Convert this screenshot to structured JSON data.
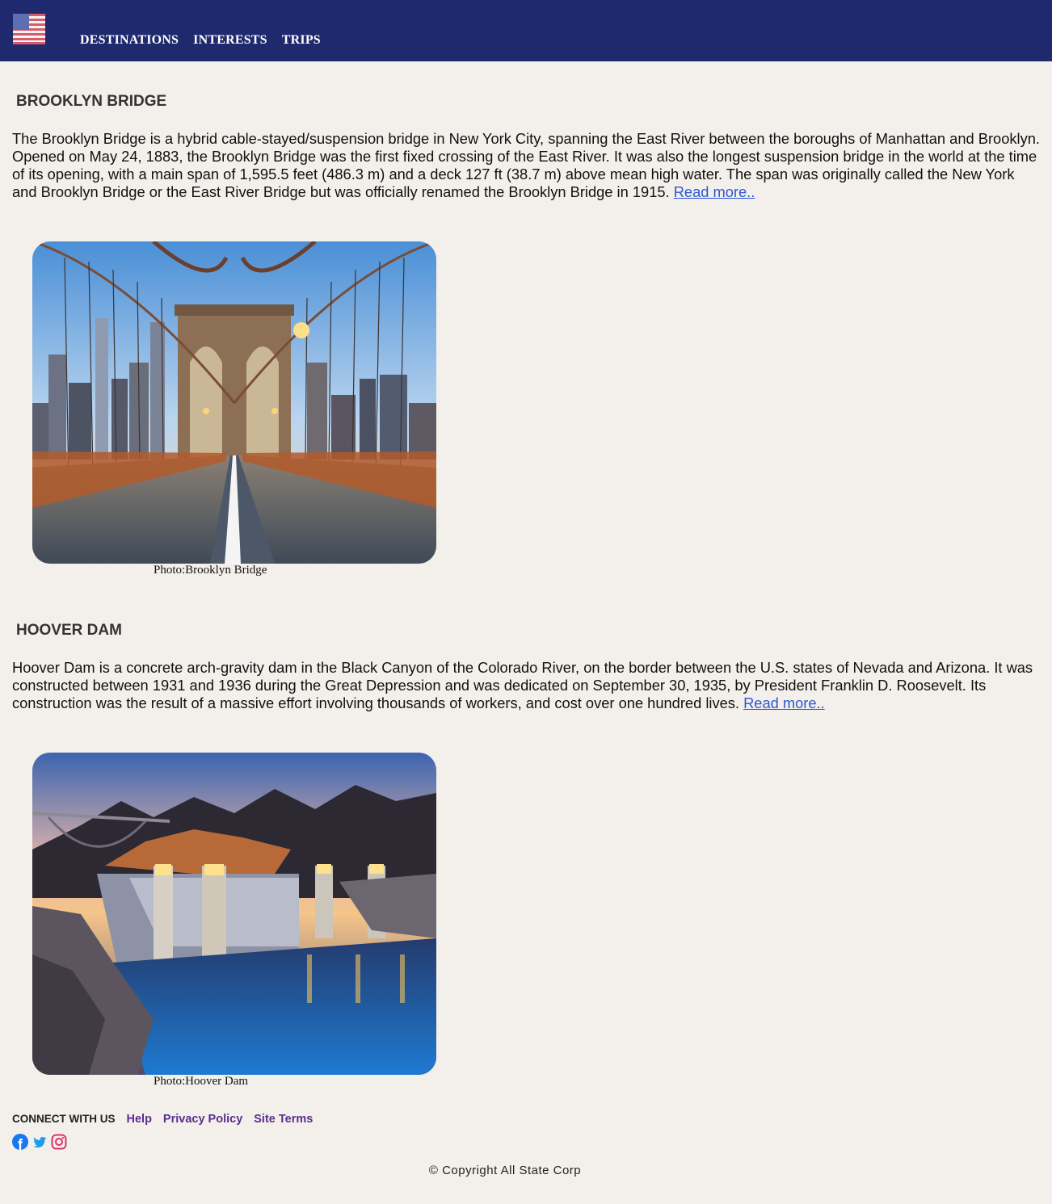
{
  "header": {
    "flag_icon": "us-flag-icon",
    "nav": [
      "DESTINATIONS",
      "INTERESTS",
      "TRIPS"
    ]
  },
  "sections": [
    {
      "title": "BROOKLYN BRIDGE",
      "text": "The Brooklyn Bridge is a hybrid cable-stayed/suspension bridge in New York City, spanning the East River between the boroughs of Manhattan and Brooklyn. Opened on May 24, 1883, the Brooklyn Bridge was the first fixed crossing of the East River. It was also the longest suspension bridge in the world at the time of its opening, with a main span of 1,595.5 feet (486.3 m) and a deck 127 ft (38.7 m) above mean high water. The span was originally called the New York and Brooklyn Bridge or the East River Bridge but was officially renamed the Brooklyn Bridge in 1915.",
      "link": "Read more..",
      "caption": "Photo:Brooklyn Bridge"
    },
    {
      "title": "HOOVER DAM",
      "text": "Hoover Dam is a concrete arch-gravity dam in the Black Canyon of the Colorado River, on the border between the U.S. states of Nevada and Arizona. It was constructed between 1931 and 1936 during the Great Depression and was dedicated on September 30, 1935, by President Franklin D. Roosevelt. Its construction was the result of a massive effort involving thousands of workers, and cost over one hundred lives.",
      "link": "Read more..",
      "caption": "Photo:Hoover Dam"
    }
  ],
  "footer": {
    "connect": "CONNECT WITH US",
    "links": [
      "Help",
      "Privacy Policy",
      "Site Terms"
    ],
    "social_icons": [
      "facebook-icon",
      "twitter-icon",
      "instagram-icon"
    ],
    "copyright": "© Copyright All State Corp"
  },
  "colors": {
    "header_bg": "#1f2a6e",
    "page_bg": "#f3f0eb",
    "link": "#2b56d6",
    "footer_link": "#5b2d8e"
  }
}
